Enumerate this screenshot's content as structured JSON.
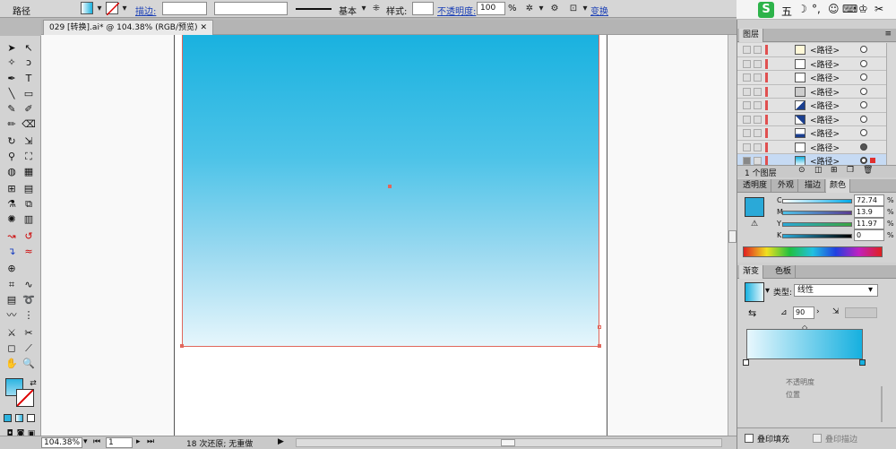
{
  "control_bar": {
    "object_type": "路径",
    "stroke_label": "描边:",
    "stroke_weight": "",
    "stroke_profile": "基本",
    "style_label": "样式:",
    "opacity_label": "不透明度:",
    "opacity_value": "100",
    "opacity_unit": "%",
    "transform_label": "变换"
  },
  "tray": {
    "ime": "五"
  },
  "document": {
    "tab_title": "029 [转换].ai* @ 104.38% (RGB/预览)"
  },
  "status_bar": {
    "zoom": "104.38%",
    "artboard": "1",
    "status_text": "18 次还原; 无重做"
  },
  "layers_panel": {
    "title": "图层",
    "rows": [
      {
        "name": "<路径>"
      },
      {
        "name": "<路径>"
      },
      {
        "name": "<路径>"
      },
      {
        "name": "<路径>"
      },
      {
        "name": "<路径>"
      },
      {
        "name": "<路径>"
      },
      {
        "name": "<路径>"
      },
      {
        "name": "<路径>"
      },
      {
        "name": "<路径>"
      }
    ],
    "footer": "1 个图层"
  },
  "color_panel": {
    "tabs": [
      "透明度",
      "外观",
      "描边",
      "颜色"
    ],
    "active_tab": "颜色",
    "fill_color": "#2aa9d8",
    "channels": [
      {
        "label": "C",
        "value": "72.74",
        "unit": "%"
      },
      {
        "label": "M",
        "value": "13.9",
        "unit": "%"
      },
      {
        "label": "Y",
        "value": "11.97",
        "unit": "%"
      },
      {
        "label": "K",
        "value": "0",
        "unit": "%"
      }
    ]
  },
  "gradient_panel": {
    "tabs": [
      "渐变",
      "色板"
    ],
    "type_label": "类型:",
    "type_value": "线性",
    "angle": "90",
    "gradient_start": "#e8f7fd",
    "gradient_end": "#16b0df"
  },
  "bottom_panel": {
    "fill_overprint": "叠印填充",
    "stroke_overprint": "叠印描边"
  },
  "colors": {
    "gradient_top": "#18b1df",
    "gradient_bottom": "#e6f6fc",
    "selection": "#e0675c"
  }
}
